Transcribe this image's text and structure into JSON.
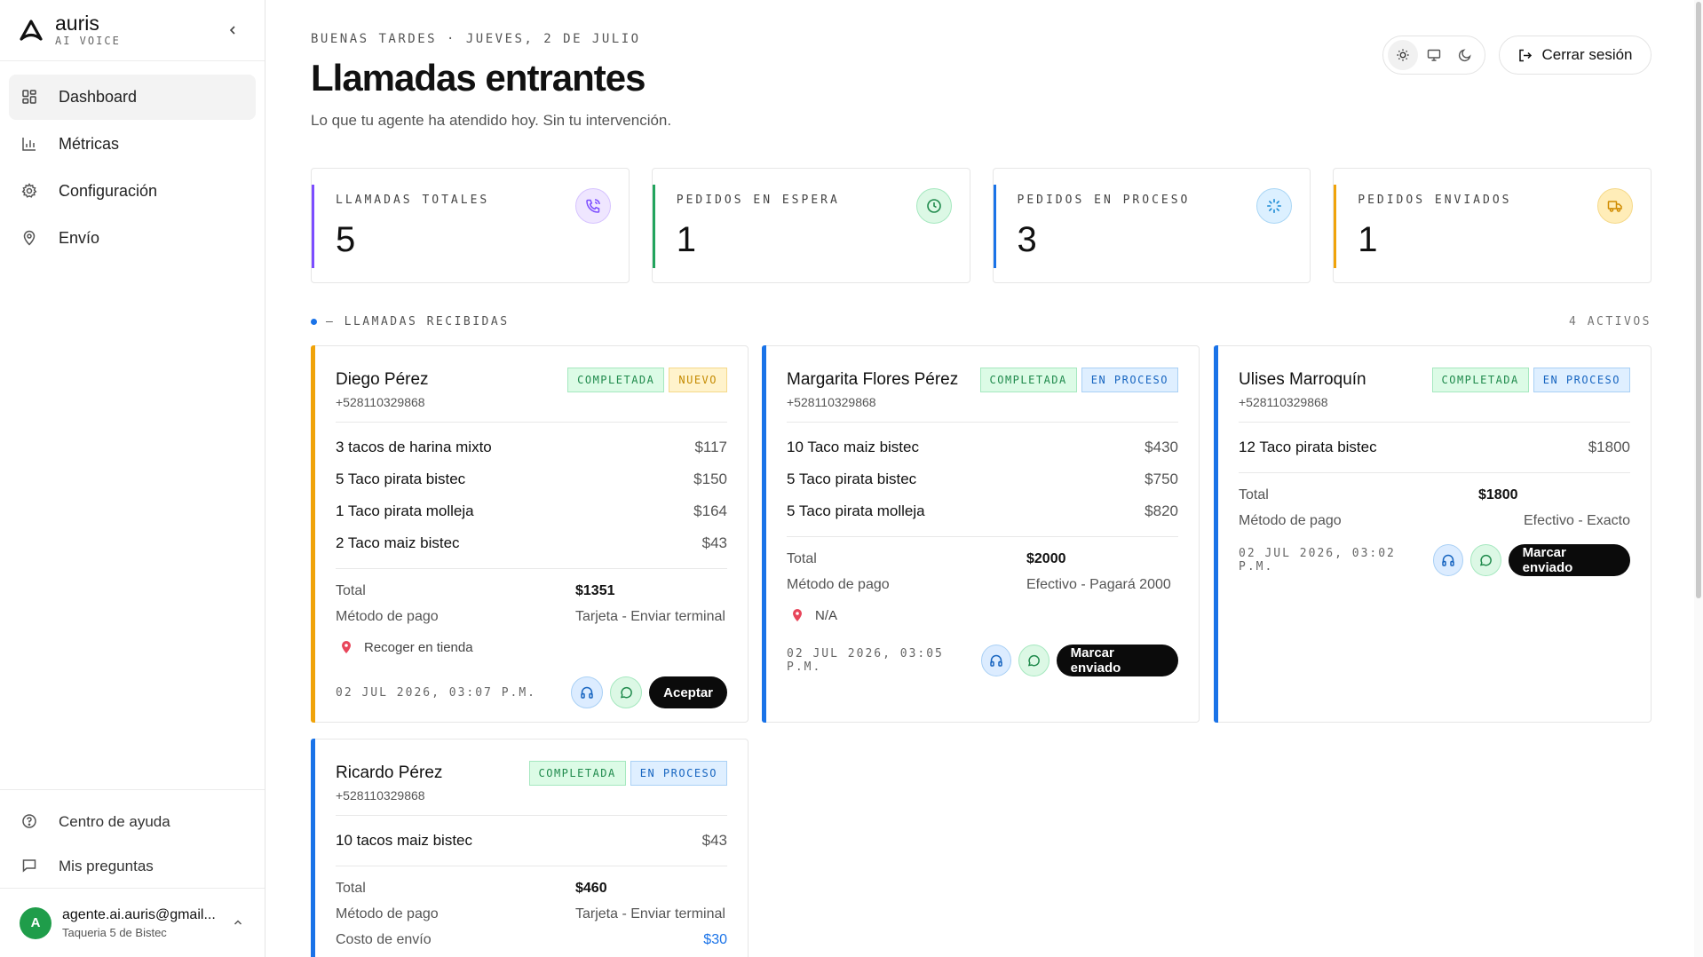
{
  "brand": {
    "name": "auris",
    "sub": "AI VOICE"
  },
  "nav": {
    "items": [
      {
        "label": "Dashboard",
        "icon": "dashboard-icon",
        "active": true
      },
      {
        "label": "Métricas",
        "icon": "bar-chart-icon"
      },
      {
        "label": "Configuración",
        "icon": "gear-icon"
      },
      {
        "label": "Envío",
        "icon": "map-pin-icon"
      }
    ],
    "bottom": [
      {
        "label": "Centro de ayuda",
        "icon": "help-circle-icon"
      },
      {
        "label": "Mis preguntas",
        "icon": "message-square-icon"
      }
    ]
  },
  "user": {
    "initial": "A",
    "email": "agente.ai.auris@gmail...",
    "business": "Taqueria 5 de Bistec",
    "avatar_color": "#1f9d4a"
  },
  "header": {
    "greeting": "BUENAS TARDES · JUEVES, 2 DE JULIO",
    "title": "Llamadas entrantes",
    "subtitle": "Lo que tu agente ha atendido hoy. Sin tu intervención.",
    "logout_label": "Cerrar sesión",
    "theme_selected": "light"
  },
  "stats": [
    {
      "label": "LLAMADAS TOTALES",
      "value": "5",
      "color": "#7c4dff",
      "icon": "phone-call-icon"
    },
    {
      "label": "PEDIDOS EN ESPERA",
      "value": "1",
      "color": "#22a45d",
      "icon": "clock-icon"
    },
    {
      "label": "PEDIDOS EN PROCESO",
      "value": "3",
      "color": "#1a73e8",
      "icon": "loader-icon"
    },
    {
      "label": "PEDIDOS ENVIADOS",
      "value": "1",
      "color": "#f0a30a",
      "icon": "truck-icon"
    }
  ],
  "section": {
    "title": "— LLAMADAS RECIBIDAS",
    "count": "4 ACTIVOS"
  },
  "labels": {
    "total": "Total",
    "payment": "Método de pago",
    "shipping": "Costo de envío"
  },
  "orders": [
    {
      "name": "Diego Pérez",
      "phone": "+528110329868",
      "tags": [
        "COMPLETADA",
        "NUEVO"
      ],
      "accent": "#f0a30a",
      "items": [
        {
          "desc": "3 tacos de harina mixto",
          "price": "$117"
        },
        {
          "desc": "5 Taco pirata bistec",
          "price": "$150"
        },
        {
          "desc": "1 Taco pirata molleja",
          "price": "$164"
        },
        {
          "desc": "2 Taco maiz bistec",
          "price": "$43"
        }
      ],
      "total": "$1351",
      "payment": "Tarjeta - Enviar terminal",
      "address": "Recoger en tienda",
      "timestamp": "02 JUL 2026, 03:07 P.M.",
      "action": "Aceptar"
    },
    {
      "name": "Margarita Flores Pérez",
      "phone": "+528110329868",
      "tags": [
        "COMPLETADA",
        "EN PROCESO"
      ],
      "accent": "#1a73e8",
      "items": [
        {
          "desc": "10 Taco maiz bistec",
          "price": "$430"
        },
        {
          "desc": "5 Taco pirata bistec",
          "price": "$750"
        },
        {
          "desc": "5 Taco pirata molleja",
          "price": "$820"
        }
      ],
      "total": "$2000",
      "payment": "Efectivo - Pagará 2000",
      "address": "N/A",
      "timestamp": "02 JUL 2026, 03:05 P.M.",
      "action": "Marcar enviado"
    },
    {
      "name": "Ulises Marroquín",
      "phone": "+528110329868",
      "tags": [
        "COMPLETADA",
        "EN PROCESO"
      ],
      "accent": "#1a73e8",
      "items": [
        {
          "desc": "12 Taco pirata bistec",
          "price": "$1800"
        }
      ],
      "total": "$1800",
      "payment": "Efectivo - Exacto",
      "timestamp": "02 JUL 2026, 03:02 P.M.",
      "action": "Marcar enviado"
    },
    {
      "name": "Ricardo Pérez",
      "phone": "+528110329868",
      "tags": [
        "COMPLETADA",
        "EN PROCESO"
      ],
      "accent": "#1a73e8",
      "items": [
        {
          "desc": "10 tacos maiz bistec",
          "price": "$43"
        }
      ],
      "total": "$460",
      "payment": "Tarjeta - Enviar terminal",
      "shipping": "$30"
    }
  ]
}
